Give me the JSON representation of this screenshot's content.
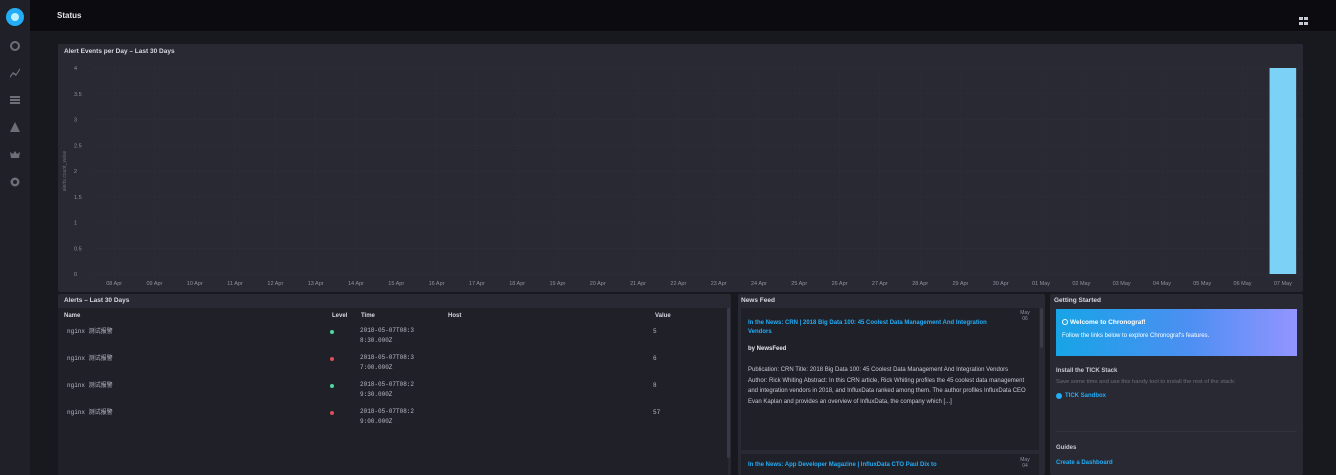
{
  "header": {
    "title": "Status"
  },
  "sidebar": {
    "items": [
      "dashboard-icon",
      "explore-icon",
      "dashboards-list-icon",
      "alerting-icon",
      "admin-crown-icon",
      "config-gear-icon"
    ]
  },
  "graph": {
    "title": "Alert Events per Day – Last 30 Days"
  },
  "chart_data": {
    "type": "bar",
    "title": "Alert Events per Day – Last 30 Days",
    "ylabel": "alerts.count_value",
    "xlabel": "",
    "ylim": [
      0,
      4
    ],
    "y_ticks": [
      "0",
      "0.5",
      "1",
      "1.5",
      "2",
      "2.5",
      "3",
      "3.5",
      "4"
    ],
    "grid": true,
    "categories": [
      "08 Apr",
      "09 Apr",
      "10 Apr",
      "11 Apr",
      "12 Apr",
      "13 Apr",
      "14 Apr",
      "15 Apr",
      "16 Apr",
      "17 Apr",
      "18 Apr",
      "19 Apr",
      "20 Apr",
      "21 Apr",
      "22 Apr",
      "23 Apr",
      "24 Apr",
      "25 Apr",
      "26 Apr",
      "27 Apr",
      "28 Apr",
      "29 Apr",
      "30 Apr",
      "01 May",
      "02 May",
      "03 May",
      "04 May",
      "05 May",
      "06 May",
      "07 May"
    ],
    "values": [
      0,
      0,
      0,
      0,
      0,
      0,
      0,
      0,
      0,
      0,
      0,
      0,
      0,
      0,
      0,
      0,
      0,
      0,
      0,
      0,
      0,
      0,
      0,
      0,
      0,
      0,
      0,
      0,
      0,
      4
    ],
    "bar_color": "#7cd2f6"
  },
  "alerts": {
    "title": "Alerts – Last 30 Days",
    "columns": {
      "name": "Name",
      "level": "Level",
      "time": "Time",
      "host": "Host",
      "value": "Value"
    },
    "rows": [
      {
        "name": "nginx 测试报警",
        "level_color": "#4ed8a0",
        "time_line1": "2018-05-07T08:3",
        "time_line2": "8:30.000Z",
        "host": "",
        "value": "5"
      },
      {
        "name": "nginx 测试报警",
        "level_color": "#dc4e58",
        "time_line1": "2018-05-07T08:3",
        "time_line2": "7:00.000Z",
        "host": "",
        "value": "6"
      },
      {
        "name": "nginx 测试报警",
        "level_color": "#4ed8a0",
        "time_line1": "2018-05-07T08:2",
        "time_line2": "9:30.000Z",
        "host": "",
        "value": "8"
      },
      {
        "name": "nginx 测试报警",
        "level_color": "#dc4e58",
        "time_line1": "2018-05-07T08:2",
        "time_line2": "9:00.000Z",
        "host": "",
        "value": "57"
      }
    ]
  },
  "news": {
    "title": "News Feed",
    "items": [
      {
        "headline": "In the News: CRN | 2018 Big Data 100: 45 Coolest Data Management And Integration Vendors",
        "date_month": "May",
        "date_day": "06",
        "author": "by NewsFeed",
        "body": "Publication: CRN Title: 2018 Big Data 100: 45 Coolest Data Management And Integration Vendors Author: Rick Whiting Abstract: In this CRN article, Rick Whiting profiles the 45 coolest data management and integration vendors in 2018, and InfluxData ranked among them. The author profiles InfluxData CEO Evan Kaplan and provides an overview of InfluxData, the company which [...]"
      },
      {
        "headline": "In the News: App Developer Magazine | InfluxData CTO Paul Dix to",
        "date_month": "May",
        "date_day": "04"
      }
    ]
  },
  "getting_started": {
    "title": "Getting Started",
    "welcome_title": "Welcome to Chronograf!",
    "welcome_body": "Follow the links below to explore Chronograf's features.",
    "tick_head": "Install the TICK Stack",
    "tick_text": "Save some time and use this handy tool to install the rest of the stack:",
    "tick_link": "TICK Sandbox",
    "guides_head": "Guides",
    "guides_link": "Create a Dashboard"
  }
}
